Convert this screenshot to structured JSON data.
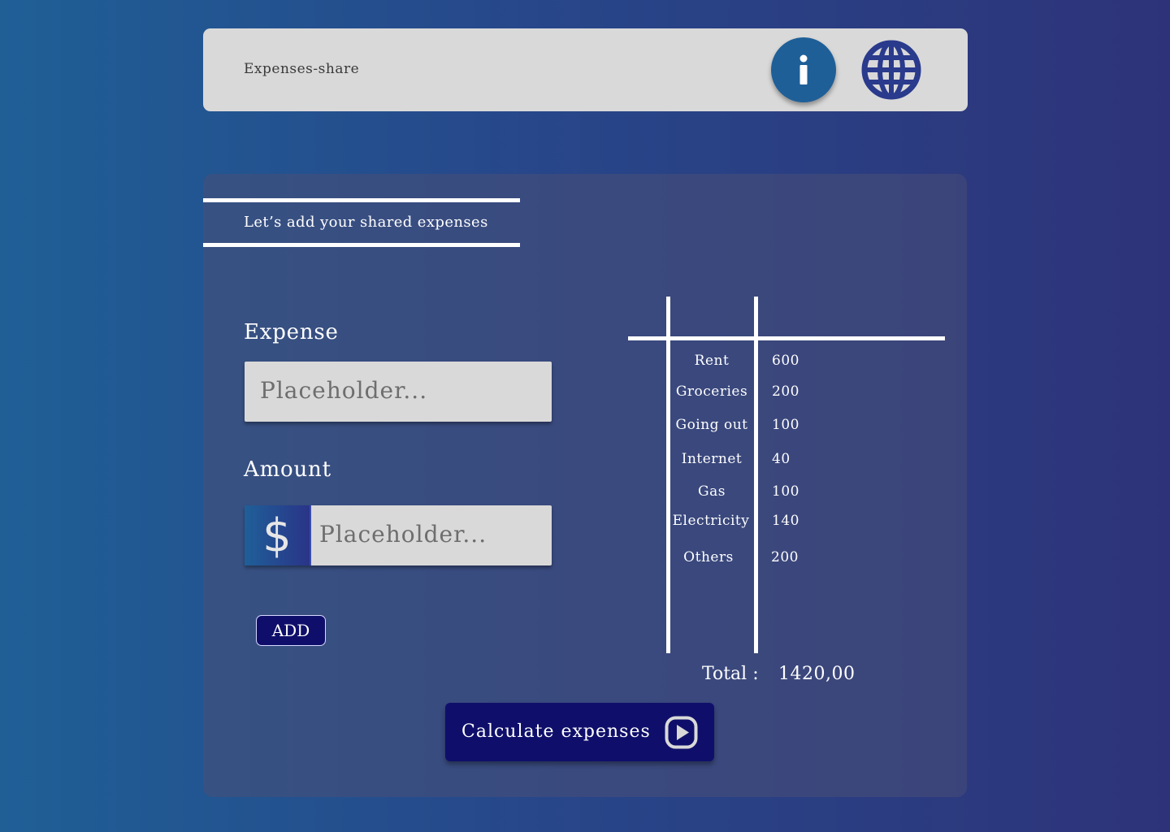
{
  "header": {
    "title": "Expenses-share",
    "info_icon": "info-icon",
    "globe_icon": "globe-icon"
  },
  "form": {
    "section_title": "Let’s add your shared expenses",
    "expense_label": "Expense",
    "expense_placeholder": "Placeholder...",
    "amount_label": "Amount",
    "currency_symbol": "$",
    "amount_placeholder": "Placeholder...",
    "add_label": "ADD"
  },
  "expenses": [
    {
      "name": "Rent",
      "amount": "600"
    },
    {
      "name": "Groceries",
      "amount": "200"
    },
    {
      "name": "Going out",
      "amount": "100"
    },
    {
      "name": "Internet",
      "amount": "40"
    },
    {
      "name": "Gas",
      "amount": "100"
    },
    {
      "name": "Electricity",
      "amount": "140"
    },
    {
      "name": "Others",
      "amount": "200"
    }
  ],
  "total": {
    "label": "Total :",
    "value": "1420,00"
  },
  "calculate_label": "Calculate expenses",
  "colors": {
    "accent_dark": "#0f0f6b",
    "accent_blue": "#1e5f98",
    "header_bg": "#d9d9d9"
  }
}
